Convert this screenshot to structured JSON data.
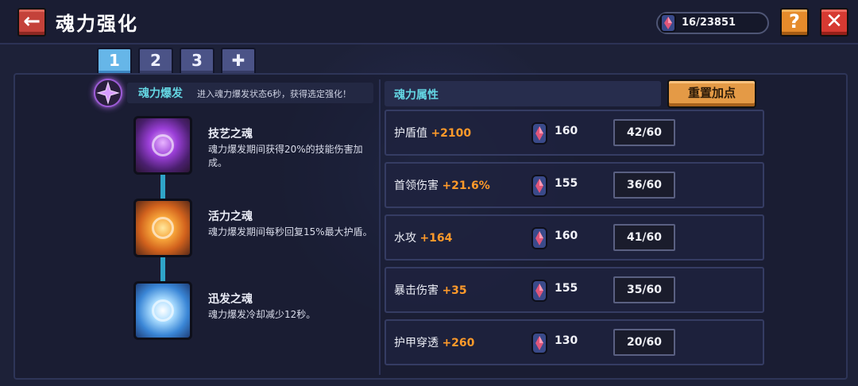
{
  "header": {
    "title": "魂力强化",
    "back_icon": "←",
    "currency_amount": "16/23851",
    "help_label": "?",
    "close_label": "✕"
  },
  "tabs": [
    {
      "label": "1",
      "active": true
    },
    {
      "label": "2",
      "active": false
    },
    {
      "label": "3",
      "active": false
    },
    {
      "label": "✚",
      "active": false
    }
  ],
  "burst": {
    "title": "魂力爆发",
    "description": "进入魂力爆发状态6秒，获得选定强化！"
  },
  "souls": [
    {
      "name": "技艺之魂",
      "description": "魂力爆发期间获得20%的技能伤害加成。",
      "icon": "skill-soul-icon"
    },
    {
      "name": "活力之魂",
      "description": "魂力爆发期间每秒回复15%最大护盾。",
      "icon": "vitality-soul-icon"
    },
    {
      "name": "迅发之魂",
      "description": "魂力爆发冷却减少12秒。",
      "icon": "swift-soul-icon"
    }
  ],
  "attributes": {
    "title": "魂力属性",
    "reset_label": "重置加点",
    "rows": [
      {
        "name": "护盾值",
        "bonus": "+2100",
        "cost": "160",
        "level": "42/60"
      },
      {
        "name": "首领伤害",
        "bonus": "+21.6%",
        "cost": "155",
        "level": "36/60"
      },
      {
        "name": "水攻",
        "bonus": "+164",
        "cost": "160",
        "level": "41/60"
      },
      {
        "name": "暴击伤害",
        "bonus": "+35",
        "cost": "155",
        "level": "35/60"
      },
      {
        "name": "护甲穿透",
        "bonus": "+260",
        "cost": "130",
        "level": "20/60"
      }
    ]
  },
  "colors": {
    "accent_cyan": "#64d6e3",
    "bonus_orange": "#ff9a2a",
    "active_tab": "#66b6e8",
    "reset_button": "#e49a46"
  }
}
